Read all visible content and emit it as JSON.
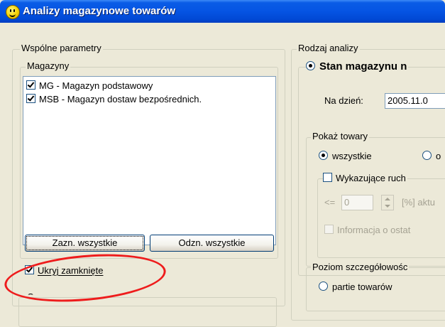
{
  "window": {
    "title": "Analizy magazynowe towarów",
    "icon": "smiley-icon"
  },
  "left": {
    "group_title": "Wspólne parametry",
    "warehouses": {
      "title": "Magazyny",
      "items": [
        {
          "label": "MG - Magazyn podstawowy",
          "checked": true
        },
        {
          "label": "MSB - Magazyn dostaw bezpośrednich.",
          "checked": true
        }
      ],
      "select_all_label": "Zazn. wszystkie",
      "deselect_all_label": "Odzn. wszystkie"
    },
    "hide_closed": {
      "label": "Ukryj zamknięte",
      "checked": true
    },
    "next_group_title": "Grupy"
  },
  "right": {
    "group_title": "Rodzaj analizy",
    "stock_state": {
      "label": "Stan magazynu n",
      "selected": true,
      "date_label": "Na dzień:",
      "date_value": "2005.11.0"
    },
    "show_goods": {
      "title": "Pokaż towary",
      "option_all": "wszystkie",
      "option_other": "o",
      "option_all_selected": true,
      "showing_movement_label": "Wykazujące ruch",
      "le_label": "<=",
      "percent_value": "0",
      "percent_suffix": "[%] aktu",
      "info_label": "Informacja o ostat"
    },
    "detail_level": {
      "title": "Poziom szczegółowośc",
      "option_batches": "partie towarów"
    }
  },
  "annotation": {
    "color": "#ee1c1c",
    "highlight": "hide-closed-checkbox"
  }
}
